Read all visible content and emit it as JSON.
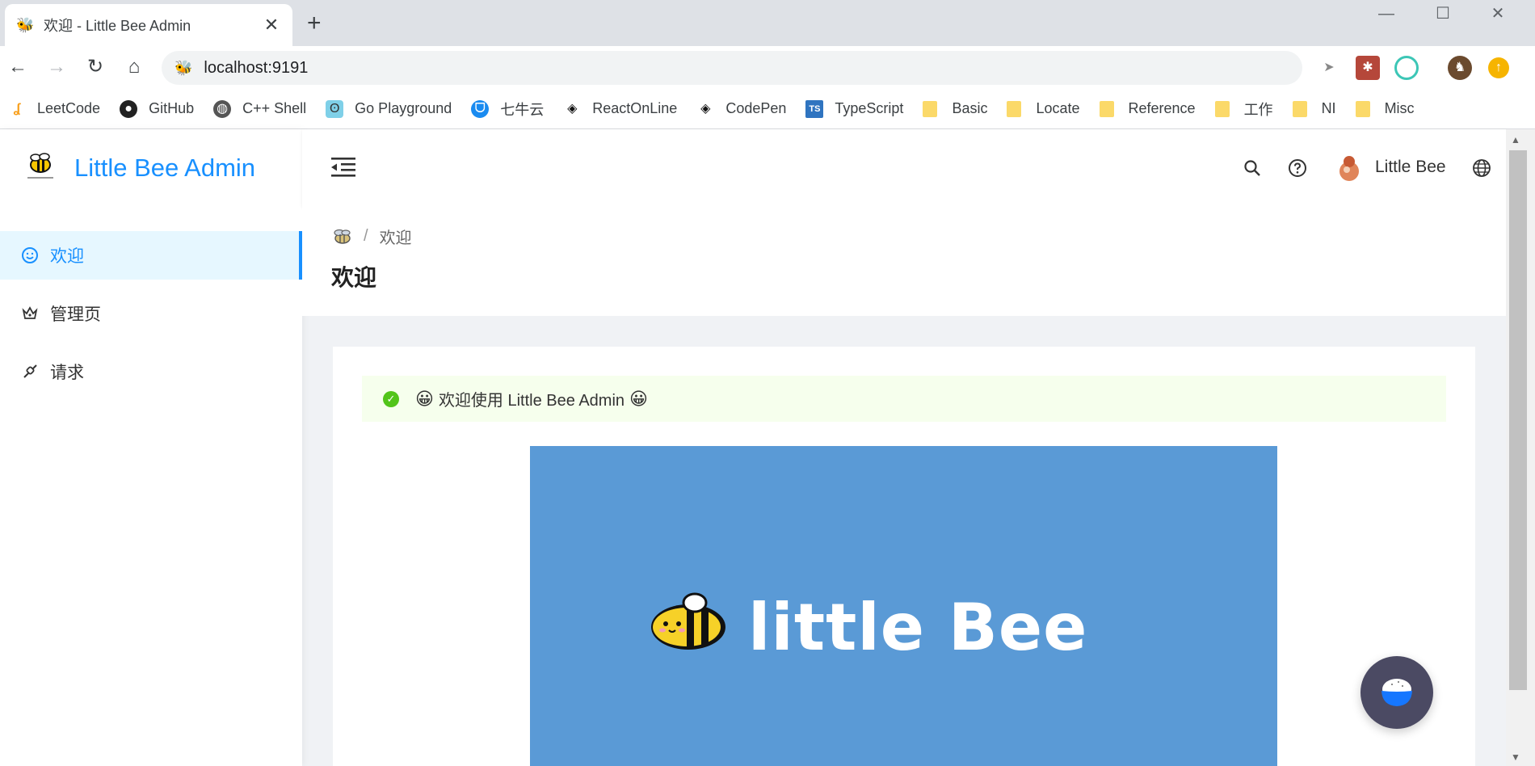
{
  "browser": {
    "tab_title": "欢迎 - Little Bee Admin",
    "url": "localhost:9191",
    "bookmarks": [
      {
        "label": "LeetCode",
        "icon": "leetcode-icon"
      },
      {
        "label": "GitHub",
        "icon": "github-icon"
      },
      {
        "label": "C++ Shell",
        "icon": "globe-icon"
      },
      {
        "label": "Go Playground",
        "icon": "gopher-icon"
      },
      {
        "label": "七牛云",
        "icon": "qiniu-icon"
      },
      {
        "label": "ReactOnLine",
        "icon": "codepen-icon"
      },
      {
        "label": "CodePen",
        "icon": "codepen-icon"
      },
      {
        "label": "TypeScript",
        "icon": "typescript-icon"
      },
      {
        "label": "Basic",
        "icon": "folder-icon"
      },
      {
        "label": "Locate",
        "icon": "folder-icon"
      },
      {
        "label": "Reference",
        "icon": "folder-icon"
      },
      {
        "label": "工作",
        "icon": "folder-icon"
      },
      {
        "label": "NI",
        "icon": "folder-icon"
      },
      {
        "label": "Misc",
        "icon": "folder-icon"
      }
    ]
  },
  "app": {
    "brand": "Little Bee Admin",
    "menu": [
      {
        "label": "欢迎",
        "icon": "smile-icon",
        "active": true
      },
      {
        "label": "管理页",
        "icon": "crown-icon",
        "active": false
      },
      {
        "label": "请求",
        "icon": "api-icon",
        "active": false
      }
    ],
    "header": {
      "user_name": "Little Bee"
    },
    "breadcrumb": {
      "current": "欢迎"
    },
    "page_title": "欢迎",
    "alert": {
      "message": "欢迎使用 Little Bee Admin",
      "emoji": "😀"
    },
    "banner_text": "little Bee"
  },
  "colors": {
    "primary": "#1890ff",
    "alert_bg": "#f6ffed",
    "success": "#52c41a",
    "banner": "#5a9ad6",
    "fab": "#4b4a63"
  }
}
